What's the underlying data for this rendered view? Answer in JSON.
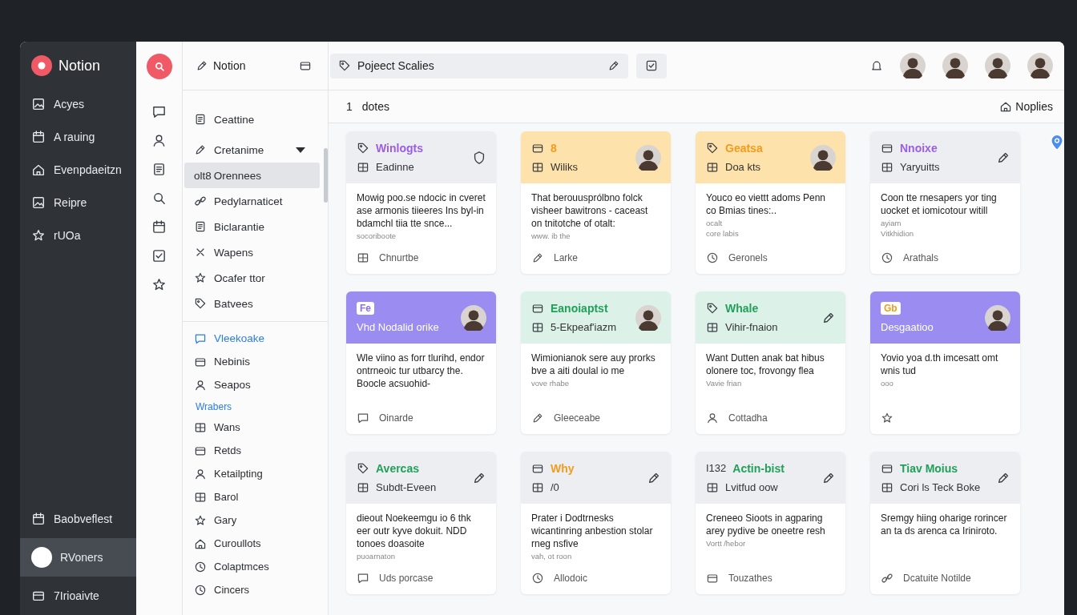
{
  "app": {
    "name": "Notion"
  },
  "sidebar": {
    "items": [
      {
        "label": "Acyes",
        "selected": false
      },
      {
        "label": "A rauing",
        "selected": false
      },
      {
        "label": "Evenpdaeitzn",
        "selected": false
      },
      {
        "label": "Reipre",
        "selected": false
      },
      {
        "label": "rUOa",
        "selected": false
      }
    ],
    "footer": [
      {
        "label": "Baobveflest",
        "selected": false
      },
      {
        "label": "RVoners",
        "selected": true
      },
      {
        "label": "7Irioaivte",
        "selected": false
      }
    ]
  },
  "pages_panel": {
    "title": "Notion",
    "items": [
      {
        "label": "Ceattine",
        "selected": false
      },
      {
        "label": "Cretanime",
        "selected": false,
        "expanded": true
      },
      {
        "prefix": "olt8",
        "label": "Orennees",
        "selected": true
      },
      {
        "label": "Pedylarnaticet",
        "selected": false
      },
      {
        "label": "Biclarantie",
        "selected": false
      },
      {
        "label": "Wapens",
        "selected": false
      },
      {
        "label": "Ocafer ttor",
        "selected": false
      },
      {
        "label": "Batvees",
        "selected": false
      }
    ],
    "links": [
      {
        "label": "Vleekoake",
        "selected": true
      },
      {
        "label": "Nebinis",
        "selected": false
      },
      {
        "label": "Seapos",
        "selected": false
      }
    ],
    "section": "Wrabers",
    "section_items": [
      {
        "label": "Wans",
        "selected": false
      },
      {
        "label": "Retds",
        "selected": false
      },
      {
        "label": "Ketailpting",
        "selected": false
      },
      {
        "label": "Barol",
        "selected": false
      },
      {
        "label": "Gary",
        "selected": false
      },
      {
        "label": "Curoullots",
        "selected": false
      },
      {
        "label": "Colaptmces",
        "selected": false
      },
      {
        "label": "Cincers",
        "selected": false
      }
    ]
  },
  "topbar": {
    "search": {
      "value": "Pojeect Scalies"
    },
    "members": [
      {
        "kind": "avatar"
      },
      {
        "kind": "avatar"
      },
      {
        "kind": "avatar"
      },
      {
        "kind": "avatar"
      }
    ]
  },
  "toolbar": {
    "count": "1",
    "label": "dotes",
    "action": "Noplies"
  },
  "cards": [
    {
      "kind": "gray",
      "title": "Winlogts",
      "subtitle": "Eadinne",
      "color": "#9b5de5",
      "avatar": false,
      "body": "Mowig poo.se ndocic in cveret ase armonis tiieeres Ins byl-in bdamchl tiia tte snce...",
      "meta": [
        "socoriboote"
      ],
      "footer": "Chnurtbe"
    },
    {
      "kind": "amber",
      "title": "8",
      "subtitle": "Wiliks",
      "color": "#f29b1d",
      "avatar": true,
      "body": "That berouusprólbno folck visheer bawitrons - caceast on tnitotche of otalt:",
      "meta": [
        "www. ib the"
      ],
      "footer": "Larke"
    },
    {
      "kind": "amber",
      "title": "Geatsa",
      "subtitle": "Doa kts",
      "color": "#f29b1d",
      "avatar": true,
      "body": "Youco eo viettt adoms Penn co Bmias tines:..",
      "meta": [
        "ocalt",
        "core labis"
      ],
      "footer": "Geronels"
    },
    {
      "kind": "gray",
      "title": "Nnoixe",
      "subtitle": "Yaryuitts",
      "color": "#9b5de5",
      "avatar": false,
      "body": "Coon tte rnesapers yor ting uocket et iomicotour witill",
      "meta": [
        "ayiam",
        "Vitkhidion"
      ],
      "footer": "Arathals"
    },
    {
      "kind": "violet",
      "title": "Fe",
      "subtitle": "Vhd Nodalid orike",
      "color": "#8a6ee8",
      "avatar": true,
      "body": "Wle viino as forr tlurihd, endor ontrneoic tur utbarcy the. Boocle acsuohid-",
      "footer": "Oinarde"
    },
    {
      "kind": "mint",
      "title": "Eanoiaptst",
      "subtitle": "5-Ekpeaf'iazm",
      "color": "#22a05a",
      "avatar": true,
      "body": "Wimionianok sere auy prorks bve a aiti doulal io me",
      "meta": [
        "vove rhabe"
      ],
      "footer": "Gleeceabe"
    },
    {
      "kind": "mint",
      "title": "Whale",
      "subtitle": "Vihir-fnaion",
      "color": "#22a05a",
      "avatar": false,
      "body": "Want Dutten anak bat hibus olonere toc, frovongy flea",
      "meta": [
        "Vavie frian"
      ],
      "footer": "Cottadha"
    },
    {
      "kind": "violet",
      "title": "Gb",
      "subtitle": "Desgaatioo",
      "color": "#f29b1d",
      "avatar": true,
      "body": "Yovio yoa d.th imcesatt omt wnis tud",
      "meta": [
        "ooo"
      ]
    },
    {
      "kind": "gray",
      "title": "Avercas",
      "subtitle": "Subdt-Eveen",
      "color": "#22a05a",
      "avatar": false,
      "body": "dieout Noekeemgu io 6 thk eer outr kyve dokuit. NDD tonoes doasoite",
      "meta": [
        "puoarnaton"
      ],
      "footer": "Uds porcase"
    },
    {
      "kind": "gray",
      "title": "Why",
      "subtitle": "/0",
      "color": "#f29b1d",
      "avatar": false,
      "body": "Prater i Dodtrnesks wicantinring anbestion stolar rneg nsfive",
      "meta": [
        "vah, ot roon"
      ],
      "footer": "Allodoic"
    },
    {
      "kind": "gray",
      "prefix": "I132",
      "title": "Actin-bist",
      "subtitle": "Lvitfud oow",
      "color": "#22a05a",
      "avatar": false,
      "body": "Creneeo Sioots in agparing arey pydive be oneetre resh",
      "meta": [
        "Vortt /hebor"
      ],
      "footer": "Touzathes"
    },
    {
      "kind": "gray",
      "title": "Tiav Moius",
      "subtitle": "Cori ls Teck Boke",
      "color": "#22a05a",
      "avatar": false,
      "body": "Sremgy hiing oharige rorincer an ta ds arenca ca Iriniroto.",
      "footer": "Dcatuite Notilde"
    }
  ]
}
